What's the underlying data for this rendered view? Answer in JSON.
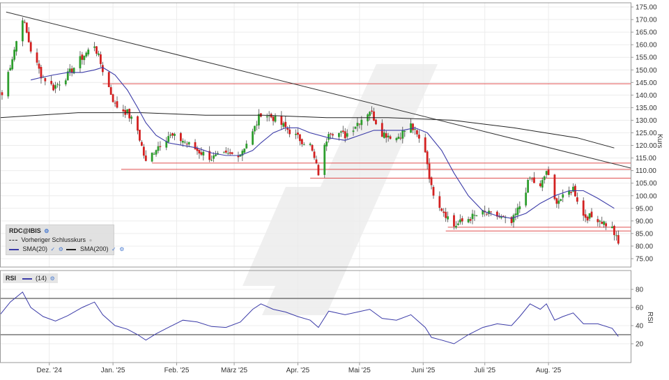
{
  "chart_data": [
    {
      "type": "candlestick",
      "ylabel": "Kurs",
      "ylim": [
        70,
        178
      ],
      "y_ticks": [
        "175.00",
        "170.00",
        "165.00",
        "160.00",
        "155.00",
        "150.00",
        "145.00",
        "140.00",
        "135.00",
        "130.00",
        "125.00",
        "120.00",
        "115.00",
        "110.00",
        "105.00",
        "100.00",
        "95.00",
        "90.00",
        "85.00",
        "80.00",
        "75.00"
      ],
      "x_ticks": [
        "Dez. '24",
        "Jan. '25",
        "Feb. '25",
        "März '25",
        "Apr. '25",
        "Mai '25",
        "Juni '25",
        "Juli '25",
        "Aug. '25"
      ],
      "x_tick_dates": [
        "2024-12-01",
        "2025-01-01",
        "2025-02-01",
        "2025-03-01",
        "2025-04-01",
        "2025-05-01",
        "2025-06-01",
        "2025-07-01",
        "2025-08-01"
      ],
      "x_range": [
        "2024-11-07",
        "2025-09-10"
      ],
      "grid": true,
      "legend": {
        "symbol": "RDC@IBIS",
        "prev_close_label": "Vorheriger Schlusskurs",
        "sma20_label": "SMA(20)",
        "sma200_label": "SMA(200)"
      },
      "colors": {
        "up": "#2e9e2e",
        "down": "#d32020",
        "sma20": "#3b3ba8",
        "sma200": "#222222",
        "hline": "#e05050",
        "trendline": "#333333"
      },
      "close_anchors": [
        {
          "x": "2024-11-08",
          "y": 140
        },
        {
          "x": "2024-11-13",
          "y": 155
        },
        {
          "x": "2024-11-18",
          "y": 171
        },
        {
          "x": "2024-11-22",
          "y": 158
        },
        {
          "x": "2024-11-27",
          "y": 148
        },
        {
          "x": "2024-12-03",
          "y": 143
        },
        {
          "x": "2024-12-10",
          "y": 148
        },
        {
          "x": "2024-12-17",
          "y": 155
        },
        {
          "x": "2024-12-23",
          "y": 160
        },
        {
          "x": "2024-12-27",
          "y": 150
        },
        {
          "x": "2025-01-02",
          "y": 136
        },
        {
          "x": "2025-01-08",
          "y": 133
        },
        {
          "x": "2025-01-13",
          "y": 126
        },
        {
          "x": "2025-01-17",
          "y": 113
        },
        {
          "x": "2025-01-22",
          "y": 119
        },
        {
          "x": "2025-01-28",
          "y": 124
        },
        {
          "x": "2025-02-04",
          "y": 122
        },
        {
          "x": "2025-02-11",
          "y": 118
        },
        {
          "x": "2025-02-18",
          "y": 115
        },
        {
          "x": "2025-02-25",
          "y": 116
        },
        {
          "x": "2025-03-04",
          "y": 117
        },
        {
          "x": "2025-03-10",
          "y": 125
        },
        {
          "x": "2025-03-14",
          "y": 133
        },
        {
          "x": "2025-03-20",
          "y": 131
        },
        {
          "x": "2025-03-26",
          "y": 127
        },
        {
          "x": "2025-04-01",
          "y": 123
        },
        {
          "x": "2025-04-07",
          "y": 120
        },
        {
          "x": "2025-04-11",
          "y": 109
        },
        {
          "x": "2025-04-16",
          "y": 126
        },
        {
          "x": "2025-04-24",
          "y": 124
        },
        {
          "x": "2025-04-30",
          "y": 129
        },
        {
          "x": "2025-05-06",
          "y": 134
        },
        {
          "x": "2025-05-12",
          "y": 125
        },
        {
          "x": "2025-05-19",
          "y": 123
        },
        {
          "x": "2025-05-26",
          "y": 128
        },
        {
          "x": "2025-06-02",
          "y": 118
        },
        {
          "x": "2025-06-05",
          "y": 103
        },
        {
          "x": "2025-06-10",
          "y": 95
        },
        {
          "x": "2025-06-16",
          "y": 88
        },
        {
          "x": "2025-06-23",
          "y": 91
        },
        {
          "x": "2025-06-30",
          "y": 93
        },
        {
          "x": "2025-07-07",
          "y": 92
        },
        {
          "x": "2025-07-14",
          "y": 89
        },
        {
          "x": "2025-07-18",
          "y": 96
        },
        {
          "x": "2025-07-23",
          "y": 107
        },
        {
          "x": "2025-07-28",
          "y": 103
        },
        {
          "x": "2025-07-31",
          "y": 110
        },
        {
          "x": "2025-08-04",
          "y": 98
        },
        {
          "x": "2025-08-08",
          "y": 99
        },
        {
          "x": "2025-08-13",
          "y": 103
        },
        {
          "x": "2025-08-18",
          "y": 92
        },
        {
          "x": "2025-08-25",
          "y": 91
        },
        {
          "x": "2025-09-01",
          "y": 87
        },
        {
          "x": "2025-09-04",
          "y": 81
        }
      ],
      "sma20": [
        {
          "x": "2024-11-22",
          "y": 146
        },
        {
          "x": "2024-11-27",
          "y": 147
        },
        {
          "x": "2024-12-03",
          "y": 148
        },
        {
          "x": "2024-12-10",
          "y": 149
        },
        {
          "x": "2024-12-17",
          "y": 149
        },
        {
          "x": "2024-12-23",
          "y": 150
        },
        {
          "x": "2024-12-27",
          "y": 151
        },
        {
          "x": "2025-01-02",
          "y": 148
        },
        {
          "x": "2025-01-08",
          "y": 142
        },
        {
          "x": "2025-01-13",
          "y": 135
        },
        {
          "x": "2025-01-17",
          "y": 129
        },
        {
          "x": "2025-01-22",
          "y": 124
        },
        {
          "x": "2025-01-28",
          "y": 121
        },
        {
          "x": "2025-02-04",
          "y": 120
        },
        {
          "x": "2025-02-11",
          "y": 119
        },
        {
          "x": "2025-02-18",
          "y": 117
        },
        {
          "x": "2025-02-25",
          "y": 116
        },
        {
          "x": "2025-03-04",
          "y": 116
        },
        {
          "x": "2025-03-10",
          "y": 118
        },
        {
          "x": "2025-03-14",
          "y": 121
        },
        {
          "x": "2025-03-20",
          "y": 125
        },
        {
          "x": "2025-03-26",
          "y": 127
        },
        {
          "x": "2025-04-01",
          "y": 127
        },
        {
          "x": "2025-04-07",
          "y": 125
        },
        {
          "x": "2025-04-16",
          "y": 123
        },
        {
          "x": "2025-04-24",
          "y": 122
        },
        {
          "x": "2025-05-01",
          "y": 124
        },
        {
          "x": "2025-05-08",
          "y": 126
        },
        {
          "x": "2025-05-15",
          "y": 126
        },
        {
          "x": "2025-05-22",
          "y": 126
        },
        {
          "x": "2025-05-28",
          "y": 127
        },
        {
          "x": "2025-06-03",
          "y": 125
        },
        {
          "x": "2025-06-10",
          "y": 118
        },
        {
          "x": "2025-06-16",
          "y": 109
        },
        {
          "x": "2025-06-23",
          "y": 100
        },
        {
          "x": "2025-06-30",
          "y": 94
        },
        {
          "x": "2025-07-07",
          "y": 92
        },
        {
          "x": "2025-07-14",
          "y": 91
        },
        {
          "x": "2025-07-21",
          "y": 93
        },
        {
          "x": "2025-07-28",
          "y": 97
        },
        {
          "x": "2025-08-04",
          "y": 100
        },
        {
          "x": "2025-08-11",
          "y": 102
        },
        {
          "x": "2025-08-18",
          "y": 102
        },
        {
          "x": "2025-08-25",
          "y": 99
        },
        {
          "x": "2025-09-02",
          "y": 95
        }
      ],
      "sma200": [
        {
          "x": "2024-11-07",
          "y": 131
        },
        {
          "x": "2024-12-15",
          "y": 133
        },
        {
          "x": "2025-01-15",
          "y": 133
        },
        {
          "x": "2025-02-15",
          "y": 132
        },
        {
          "x": "2025-03-15",
          "y": 132
        },
        {
          "x": "2025-04-15",
          "y": 131
        },
        {
          "x": "2025-05-15",
          "y": 131
        },
        {
          "x": "2025-06-15",
          "y": 130
        },
        {
          "x": "2025-07-15",
          "y": 127
        },
        {
          "x": "2025-08-15",
          "y": 123
        },
        {
          "x": "2025-09-02",
          "y": 119
        }
      ],
      "horizontal_lines": [
        {
          "x0": "2024-12-27",
          "x1": "2025-09-10",
          "y": 144.5
        },
        {
          "x0": "2025-01-20",
          "x1": "2025-09-10",
          "y": 113
        },
        {
          "x0": "2025-01-05",
          "x1": "2025-09-10",
          "y": 110.5
        },
        {
          "x0": "2025-04-07",
          "x1": "2025-09-10",
          "y": 107
        },
        {
          "x0": "2025-06-13",
          "x1": "2025-09-10",
          "y": 87.5
        },
        {
          "x0": "2025-06-12",
          "x1": "2025-09-10",
          "y": 86
        }
      ],
      "trendline": {
        "x0": "2024-11-10",
        "y0": 173,
        "x1": "2025-09-10",
        "y1": 111
      }
    },
    {
      "type": "line",
      "name": "RSI",
      "legend_label": "RSI",
      "period_label": "(14)",
      "ylim": [
        10,
        90
      ],
      "y_ticks": [
        80,
        60,
        40,
        20
      ],
      "y_tick_labels": [
        "80",
        "60",
        "40",
        "20"
      ],
      "ylabel": "RSI",
      "levels": [
        70,
        30
      ],
      "color": "#3b3ba8",
      "points": [
        {
          "x": "2024-11-07",
          "y": 52
        },
        {
          "x": "2024-11-12",
          "y": 66
        },
        {
          "x": "2024-11-18",
          "y": 77
        },
        {
          "x": "2024-11-22",
          "y": 60
        },
        {
          "x": "2024-11-28",
          "y": 50
        },
        {
          "x": "2024-12-04",
          "y": 45
        },
        {
          "x": "2024-12-10",
          "y": 51
        },
        {
          "x": "2024-12-17",
          "y": 60
        },
        {
          "x": "2024-12-23",
          "y": 66
        },
        {
          "x": "2024-12-27",
          "y": 52
        },
        {
          "x": "2025-01-02",
          "y": 40
        },
        {
          "x": "2025-01-08",
          "y": 36
        },
        {
          "x": "2025-01-13",
          "y": 30
        },
        {
          "x": "2025-01-17",
          "y": 24
        },
        {
          "x": "2025-01-22",
          "y": 31
        },
        {
          "x": "2025-01-28",
          "y": 38
        },
        {
          "x": "2025-02-04",
          "y": 46
        },
        {
          "x": "2025-02-11",
          "y": 44
        },
        {
          "x": "2025-02-18",
          "y": 39
        },
        {
          "x": "2025-02-25",
          "y": 38
        },
        {
          "x": "2025-03-04",
          "y": 44
        },
        {
          "x": "2025-03-10",
          "y": 58
        },
        {
          "x": "2025-03-14",
          "y": 64
        },
        {
          "x": "2025-03-20",
          "y": 58
        },
        {
          "x": "2025-03-26",
          "y": 55
        },
        {
          "x": "2025-04-01",
          "y": 50
        },
        {
          "x": "2025-04-07",
          "y": 46
        },
        {
          "x": "2025-04-11",
          "y": 38
        },
        {
          "x": "2025-04-16",
          "y": 56
        },
        {
          "x": "2025-04-24",
          "y": 52
        },
        {
          "x": "2025-04-30",
          "y": 55
        },
        {
          "x": "2025-05-06",
          "y": 58
        },
        {
          "x": "2025-05-12",
          "y": 48
        },
        {
          "x": "2025-05-19",
          "y": 46
        },
        {
          "x": "2025-05-26",
          "y": 52
        },
        {
          "x": "2025-06-02",
          "y": 38
        },
        {
          "x": "2025-06-05",
          "y": 27
        },
        {
          "x": "2025-06-10",
          "y": 24
        },
        {
          "x": "2025-06-16",
          "y": 20
        },
        {
          "x": "2025-06-23",
          "y": 30
        },
        {
          "x": "2025-06-30",
          "y": 38
        },
        {
          "x": "2025-07-07",
          "y": 42
        },
        {
          "x": "2025-07-14",
          "y": 40
        },
        {
          "x": "2025-07-18",
          "y": 50
        },
        {
          "x": "2025-07-23",
          "y": 64
        },
        {
          "x": "2025-07-28",
          "y": 58
        },
        {
          "x": "2025-07-31",
          "y": 64
        },
        {
          "x": "2025-08-04",
          "y": 46
        },
        {
          "x": "2025-08-08",
          "y": 50
        },
        {
          "x": "2025-08-13",
          "y": 54
        },
        {
          "x": "2025-08-18",
          "y": 42
        },
        {
          "x": "2025-08-25",
          "y": 42
        },
        {
          "x": "2025-09-01",
          "y": 37
        },
        {
          "x": "2025-09-04",
          "y": 28
        }
      ]
    }
  ]
}
